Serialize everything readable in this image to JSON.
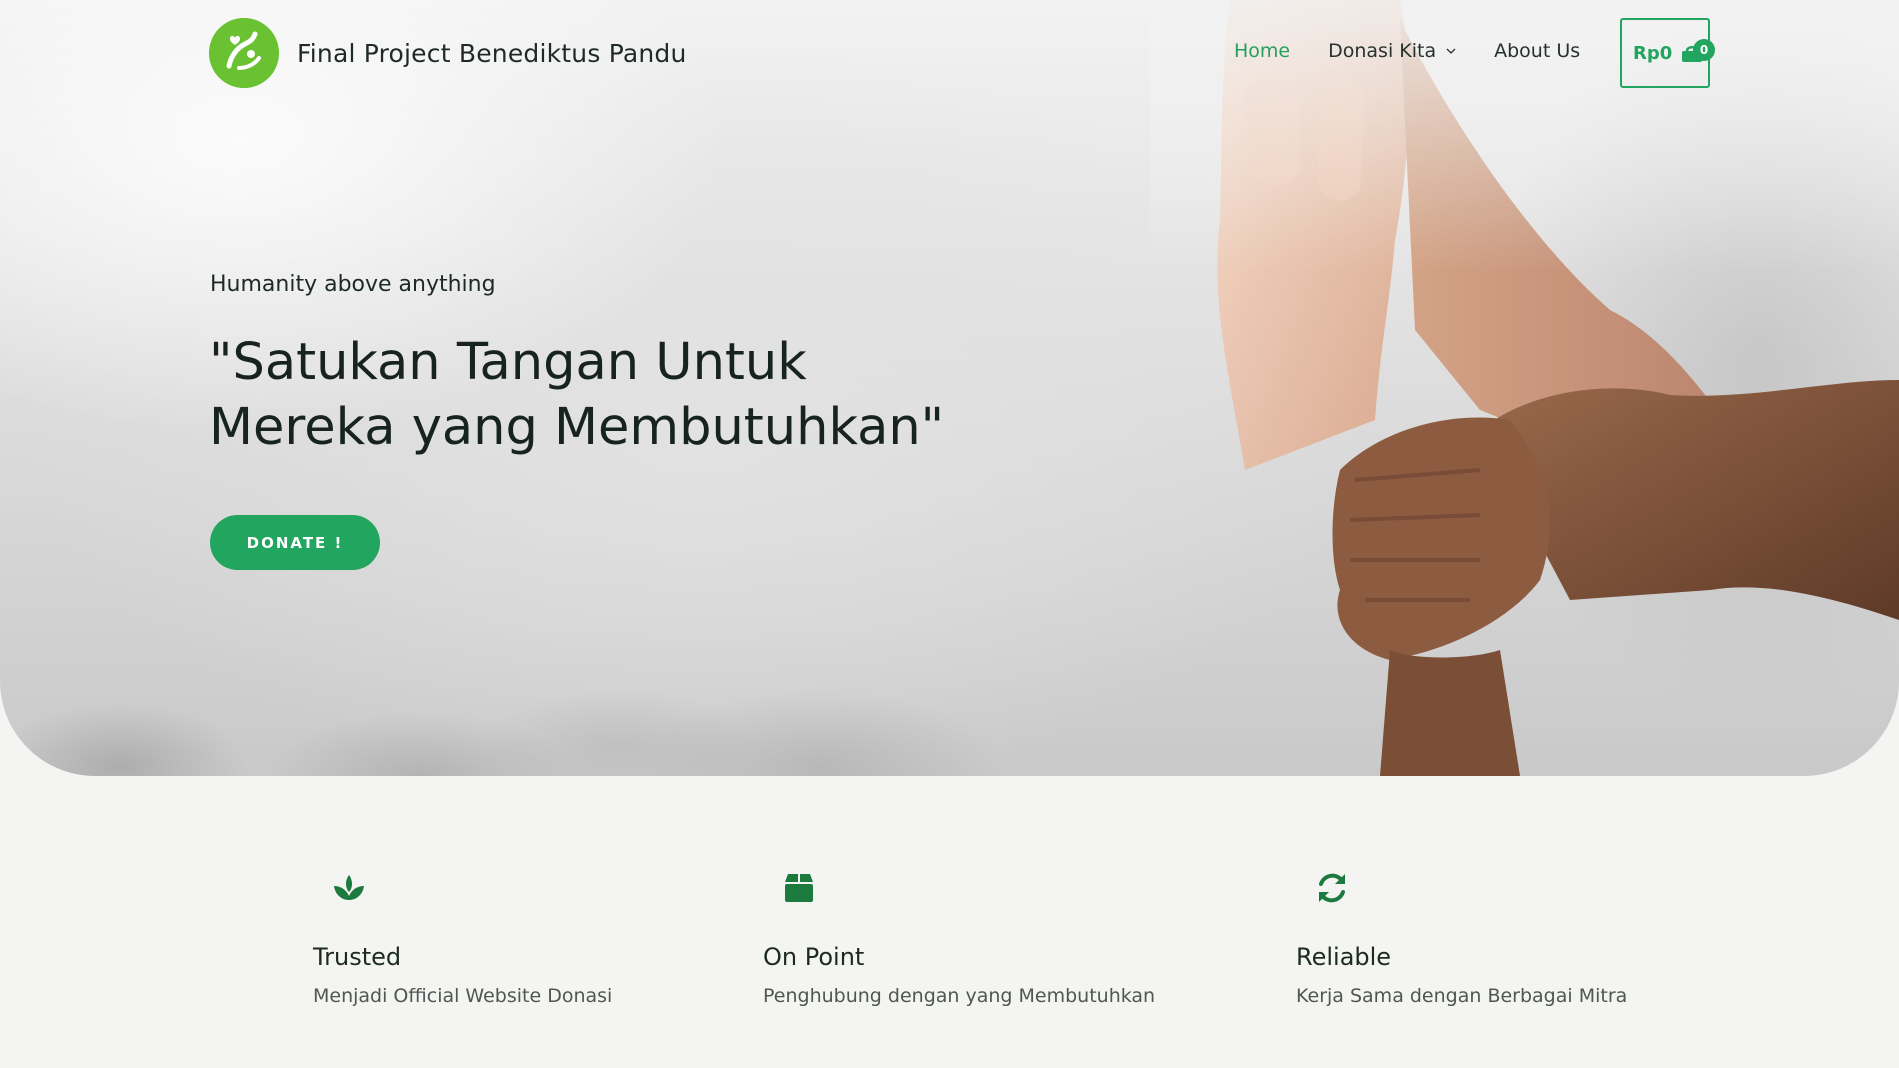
{
  "site": {
    "title": "Final Project Benediktus Pandu"
  },
  "nav": {
    "items": [
      {
        "label": "Home",
        "active": true
      },
      {
        "label": "Donasi Kita",
        "has_dropdown": true
      },
      {
        "label": "About Us"
      }
    ],
    "cart": {
      "price": "Rp0",
      "count": "0"
    }
  },
  "hero": {
    "tagline": "Humanity above anything",
    "headline_line1": "\"Satukan Tangan Untuk",
    "headline_line2": "Mereka yang Membutuhkan\"",
    "cta_label": "DONATE !"
  },
  "features": [
    {
      "icon": "seedling-icon",
      "title": "Trusted",
      "description": "Menjadi Official Website Donasi"
    },
    {
      "icon": "box-icon",
      "title": "On Point",
      "description": "Penghubung dengan yang Membutuhkan"
    },
    {
      "icon": "sync-icon",
      "title": "Reliable",
      "description": "Kerja Sama dengan Berbagai Mitra"
    }
  ],
  "colors": {
    "accent": "#21a55f",
    "logo_green": "#6ac232",
    "icon_green": "#1c7a3f",
    "background": "#f4f5f3"
  }
}
